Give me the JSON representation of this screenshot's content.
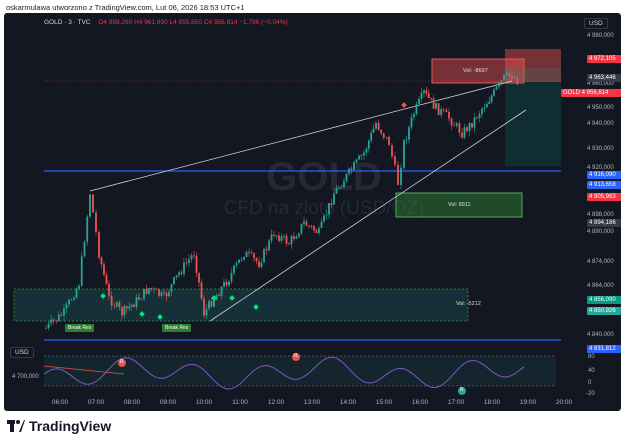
{
  "caption": "oskarmulawa utworzono z TradingView.com, Lut 06, 2026 18:53 UTC+1",
  "header": {
    "symbol": "GOLD · 3 · TVC",
    "ohlc": "O4 958,260  H4 961,650  L4 955,850  C4 956,614  −1,796 (−0,04%)",
    "currency_top": "USD",
    "currency_bottom": "USD"
  },
  "watermark": {
    "line1": "GOLD",
    "line2": "CFD na złoto (USD/OZ)"
  },
  "price_scale": {
    "ticks": [
      "4 980,000",
      "4 970,000",
      "4 960,000",
      "4 950,000",
      "4 940,000",
      "4 930,000",
      "4 920,000",
      "4 898,000",
      "4 890,000",
      "4 874,000",
      "4 864,000",
      "4 848,000",
      "4 840,000"
    ],
    "labels": [
      {
        "text": "4 972,105",
        "color": "#f23645"
      },
      {
        "text": "4 963,446",
        "color": "#b2b5be"
      },
      {
        "text": "GOLD 4 956,614",
        "color": "#f23645"
      },
      {
        "text": "4 916,090",
        "color": "#2962ff"
      },
      {
        "text": "4 913,658",
        "color": "#2962ff"
      },
      {
        "text": "4 905,963",
        "color": "#f23645"
      },
      {
        "text": "4 894,186",
        "color": "#b2b5be"
      },
      {
        "text": "4 856,090",
        "color": "#089981"
      },
      {
        "text": "4 850,926",
        "color": "#26a69a"
      },
      {
        "text": "4 831,812",
        "color": "#2962ff"
      }
    ]
  },
  "time_axis": [
    "06:00",
    "07:00",
    "08:00",
    "09:00",
    "10:00",
    "11:00",
    "12:00",
    "13:00",
    "14:00",
    "15:00",
    "16:00",
    "17:00",
    "18:00",
    "19:00",
    "20:00"
  ],
  "annotations": {
    "vol_top": "Vol: -8697",
    "vol_mid": "Vol: 8911",
    "vol_bottom": "Vol: -5212",
    "break_res_1": "Break Res",
    "break_res_2": "Break Res",
    "indicator_left_value": "4 700,000",
    "osc_ticks": [
      "80",
      "40",
      "0",
      "-20"
    ],
    "r_marks": [
      "R",
      "R",
      "R"
    ]
  },
  "footer": {
    "brand": "TradingView"
  },
  "colors": {
    "bg": "#131722",
    "up": "#26a69a",
    "down": "#ef5350",
    "accent": "#2962ff"
  }
}
